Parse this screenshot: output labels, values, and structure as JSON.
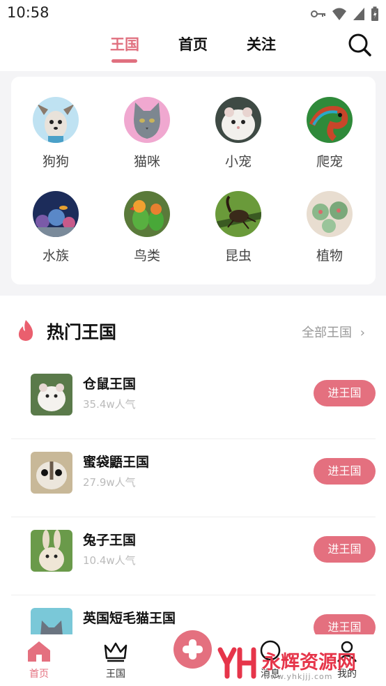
{
  "status_bar": {
    "time": "10:58"
  },
  "top_tabs": {
    "items": [
      "王国",
      "首页",
      "关注"
    ],
    "active": "王国"
  },
  "categories": [
    "狗狗",
    "猫咪",
    "小宠",
    "爬宠",
    "水族",
    "鸟类",
    "昆虫",
    "植物"
  ],
  "hot": {
    "title": "热门王国",
    "all_link": "全部王国",
    "items": [
      {
        "name": "仓鼠王国",
        "popularity": "35.4w人气",
        "button": "进王国"
      },
      {
        "name": "蜜袋鼯王国",
        "popularity": "27.9w人气",
        "button": "进王国"
      },
      {
        "name": "兔子王国",
        "popularity": "10.4w人气",
        "button": "进王国"
      },
      {
        "name": "英国短毛猫王国",
        "popularity": "",
        "button": "进王国"
      }
    ]
  },
  "bottom_nav": {
    "items": [
      "首页",
      "王国",
      "消息",
      "我的"
    ],
    "active": "首页"
  },
  "watermark": {
    "text": "永辉资源网",
    "url": "www.yhkjjj.com"
  },
  "colors": {
    "accent": "#e4707f",
    "background": "#f4f4f6"
  }
}
